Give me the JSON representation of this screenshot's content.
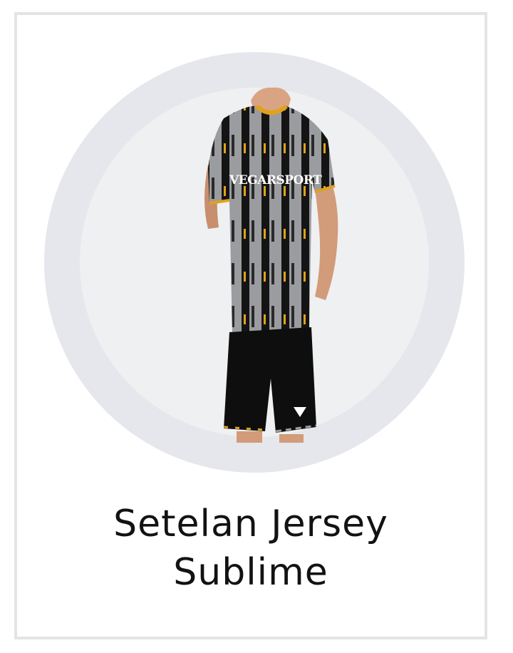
{
  "product": {
    "title_line1": "Setelan Jersey",
    "title_line2": "Sublime",
    "image_icon": "jersey-set-photo",
    "jersey_print_text": "VEGARSPORT"
  },
  "colors": {
    "ring": "#e6e7ec",
    "inner_circle": "#eff0f1",
    "border": "#e4e4e4",
    "title": "#121212",
    "jersey_black": "#141414",
    "jersey_grey": "#9a9c9f",
    "jersey_accent": "#e0a21c"
  }
}
